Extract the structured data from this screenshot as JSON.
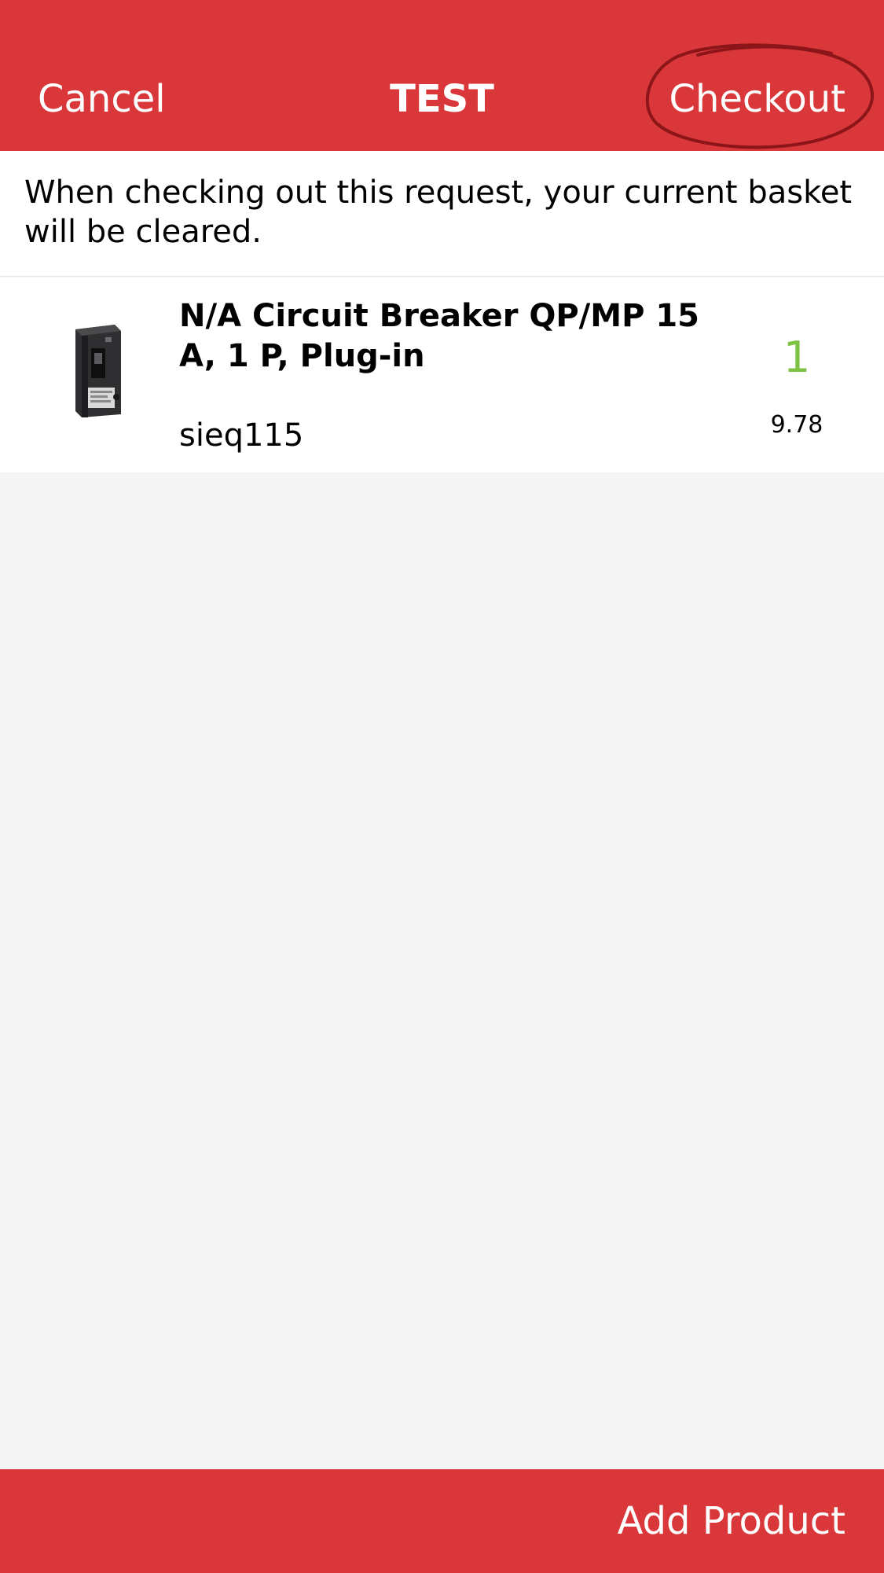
{
  "navbar": {
    "cancel_label": "Cancel",
    "title": "TEST",
    "checkout_label": "Checkout",
    "background_color": "#da373a",
    "annotation_color": "#8b1518"
  },
  "notice": {
    "text": "When checking out this request, your current basket will be cleared."
  },
  "items": [
    {
      "title": "N/A Circuit Breaker QP/MP 15 A, 1 P, Plug-in",
      "sku": "sieq115",
      "quantity": "1",
      "price": "9.78",
      "image_icon": "circuit-breaker-icon"
    }
  ],
  "footer": {
    "add_product_label": "Add Product"
  },
  "colors": {
    "accent": "#da373a",
    "quantity": "#7dc242",
    "background": "#f4f4f4"
  }
}
